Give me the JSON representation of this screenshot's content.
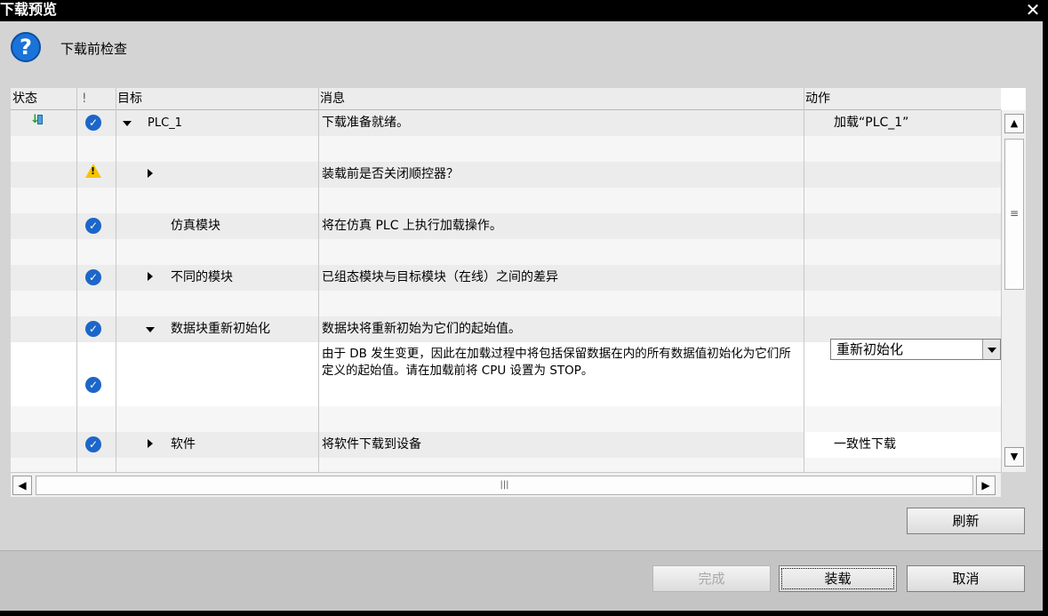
{
  "window": {
    "title": "下载预览",
    "close_glyph": "✕"
  },
  "header": {
    "icon": "question-icon",
    "icon_glyph": "?",
    "label": "下载前检查"
  },
  "columns": {
    "status": "状态",
    "flag": "!",
    "target": "目标",
    "message": "消息",
    "action": "动作"
  },
  "rows": [
    {
      "status_icon": "download-device-icon",
      "flag_icon": "check-warning-icon",
      "expander": "expanded",
      "target": "PLC_1",
      "message": "下载准备就绪。",
      "action": "加载“PLC_1”"
    },
    {
      "flag_icon": "warning-icon",
      "expander": "collapsed",
      "target": "",
      "message": "装载前是否关闭顺控器？",
      "action": ""
    },
    {
      "flag_icon": "check-icon",
      "target": "仿真模块",
      "message": "将在仿真 PLC 上执行加载操作。",
      "action": ""
    },
    {
      "flag_icon": "check-icon",
      "expander": "collapsed",
      "target": "不同的模块",
      "message": "已组态模块与目标模块（在线）之间的差异",
      "action": ""
    },
    {
      "flag_icon": "check-icon",
      "expander": "expanded",
      "target": "数据块重新初始化",
      "message": "数据块将重新初始为它们的起始值。",
      "action": "重新初始化"
    },
    {
      "flag_icon": "check-icon",
      "target": "",
      "message": "由于 DB 发生变更，因此在加载过程中将包括保留数据在内的所有数据值初始化为它们所定义的起始值。请在加载前将 CPU 设置为 STOP。",
      "action": ""
    },
    {
      "flag_icon": "check-icon",
      "expander": "collapsed",
      "target": "软件",
      "message": "将软件下载到设备",
      "action": "一致性下载"
    }
  ],
  "check_glyph": "✓",
  "warn_glyph": "!",
  "scroll": {
    "up": "▲",
    "down": "▼",
    "left": "◀",
    "right": "▶",
    "v_grip": "≡",
    "h_grip": "|||"
  },
  "buttons": {
    "refresh": "刷新",
    "finish": "完成",
    "load": "装载",
    "cancel": "取消"
  },
  "colors": {
    "accent_blue": "#1d66c9",
    "warning_yellow": "#f5c400",
    "title_bg": "#000000"
  }
}
